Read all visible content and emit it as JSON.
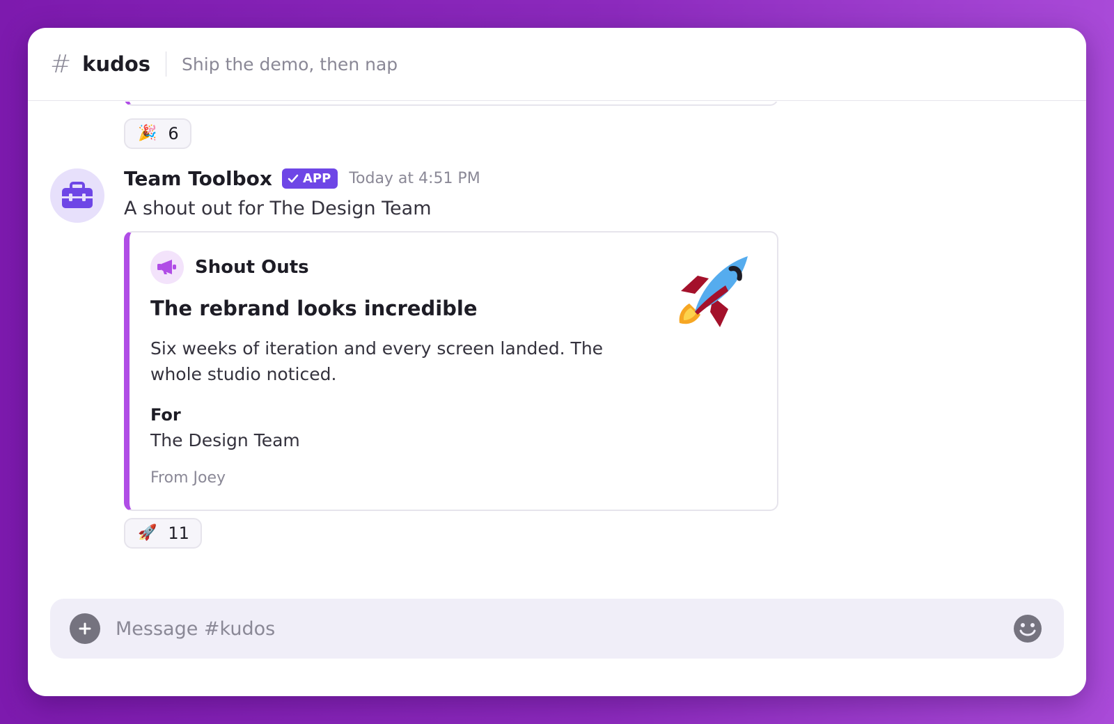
{
  "channel": {
    "hash_symbol": "#",
    "name": "kudos",
    "topic": "Ship the demo, then nap"
  },
  "previous_message": {
    "reaction": {
      "emoji": "🎉",
      "count": "6"
    }
  },
  "message": {
    "sender": "Team Toolbox",
    "badge": "APP",
    "timestamp": "Today at 4:51 PM",
    "text": "A shout out for The Design Team",
    "avatar_icon": "toolbox-icon",
    "card": {
      "app_icon": "megaphone-icon",
      "app_name": "Shout Outs",
      "title": "The rebrand looks incredible",
      "body": "Six weeks of iteration and every screen landed. The whole studio noticed.",
      "for_label": "For",
      "for_value": "The Design Team",
      "from": "From Joey",
      "illustration": "rocket-icon"
    },
    "reaction": {
      "emoji": "🚀",
      "count": "11"
    }
  },
  "composer": {
    "placeholder": "Message #kudos",
    "plus_label": "+",
    "emoji_icon": "smiley-icon"
  },
  "colors": {
    "accent": "#b04de6",
    "badge": "#6e46e6",
    "avatar_bg": "#e7e0fb"
  }
}
